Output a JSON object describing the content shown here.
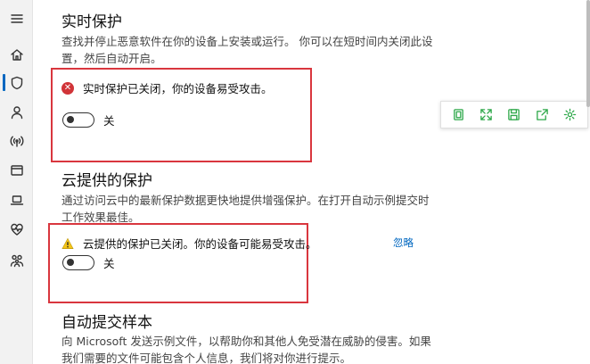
{
  "sidebar": {
    "items": [
      {
        "icon": "hamburger-menu-icon",
        "label": ""
      },
      {
        "icon": "home-icon",
        "label": ""
      },
      {
        "icon": "shield-icon",
        "label": ""
      },
      {
        "icon": "person-icon",
        "label": ""
      },
      {
        "icon": "wifi-antenna-icon",
        "label": ""
      },
      {
        "icon": "browser-window-icon",
        "label": ""
      },
      {
        "icon": "laptop-icon",
        "label": ""
      },
      {
        "icon": "heart-pulse-icon",
        "label": ""
      },
      {
        "icon": "family-icon",
        "label": ""
      }
    ],
    "active_index": 2,
    "accent": "#0067c0"
  },
  "sections": {
    "realtime": {
      "title": "实时保护",
      "description": "查找并停止恶意软件在你的设备上安装或运行。 你可以在短时间内关闭此设置，然后自动开启。",
      "alert_text": "实时保护已关闭，你的设备易受攻击。",
      "alert_icon": "error-x-icon",
      "toggle_state": "off",
      "toggle_label": "关"
    },
    "cloud": {
      "title": "云提供的保护",
      "description": "通过访问云中的最新保护数据更快地提供增强保护。在打开自动示例提交时工作效果最佳。",
      "alert_text": "云提供的保护已关闭。你的设备可能易受攻击。",
      "alert_icon": "warning-triangle-icon",
      "dismiss_label": "忽略",
      "toggle_state": "off",
      "toggle_label": "关"
    },
    "sample": {
      "title": "自动提交样本",
      "description": "向 Microsoft 发送示例文件，以帮助你和其他人免受潜在威胁的侵害。如果我们需要的文件可能包含个人信息，我们将对你进行提示。"
    }
  },
  "floating_toolbar": {
    "icons": [
      "copy-icon",
      "expand-icon",
      "save-icon",
      "share-export-icon",
      "settings-gear-icon"
    ],
    "color": "#2ea84a"
  },
  "highlight_color": "#d9363e",
  "error_color": "#d13438",
  "warning_color": "#f5c518"
}
